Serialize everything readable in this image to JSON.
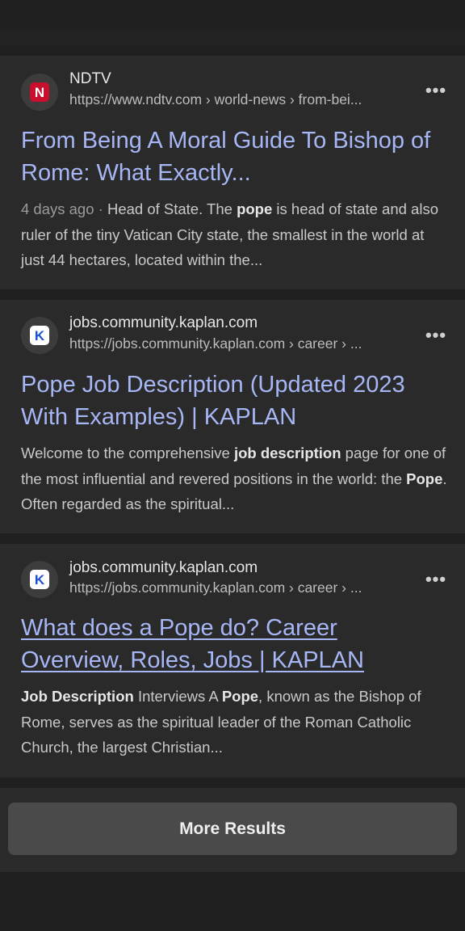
{
  "results": [
    {
      "site_name": "NDTV",
      "url": "https://www.ndtv.com › world-news › from-bei...",
      "favicon": "ndtv-logo",
      "favicon_letter": "N",
      "title": "From Being A Moral Guide To Bishop of Rome: What Exactly...",
      "date": "4 days ago",
      "snippet_parts": [
        {
          "text": "Head of State. The ",
          "bold": false
        },
        {
          "text": "pope",
          "bold": true
        },
        {
          "text": " is head of state and also ruler of the tiny Vatican City state, the smallest in the world at just 44 hectares, located within the...",
          "bold": false
        }
      ]
    },
    {
      "site_name": "jobs.community.kaplan.com",
      "url": "https://jobs.community.kaplan.com › career › ...",
      "favicon": "kaplan-logo",
      "favicon_letter": "K",
      "title": "Pope Job Description (Updated 2023 With Examples) | KAPLAN",
      "snippet_parts": [
        {
          "text": "Welcome to the comprehensive ",
          "bold": false
        },
        {
          "text": "job description",
          "bold": true
        },
        {
          "text": " page for one of the most influential and revered positions in the world: the ",
          "bold": false
        },
        {
          "text": "Pope",
          "bold": true
        },
        {
          "text": ". Often regarded as the spiritual...",
          "bold": false
        }
      ]
    },
    {
      "site_name": "jobs.community.kaplan.com",
      "url": "https://jobs.community.kaplan.com › career › ...",
      "favicon": "kaplan-logo",
      "favicon_letter": "K",
      "title": "What does a Pope do? Career Overview, Roles, Jobs | KAPLAN",
      "snippet_parts": [
        {
          "text": "Job Description",
          "bold": true
        },
        {
          "text": " Interviews A ",
          "bold": false
        },
        {
          "text": "Pope",
          "bold": true
        },
        {
          "text": ", known as the Bishop of Rome, serves as the spiritual leader of the Roman Catholic Church, the largest Christian...",
          "bold": false
        }
      ]
    }
  ],
  "more_icon": "more-horizontal-icon",
  "more_glyph": "•••",
  "date_separator": " · ",
  "more_results_label": "More Results"
}
